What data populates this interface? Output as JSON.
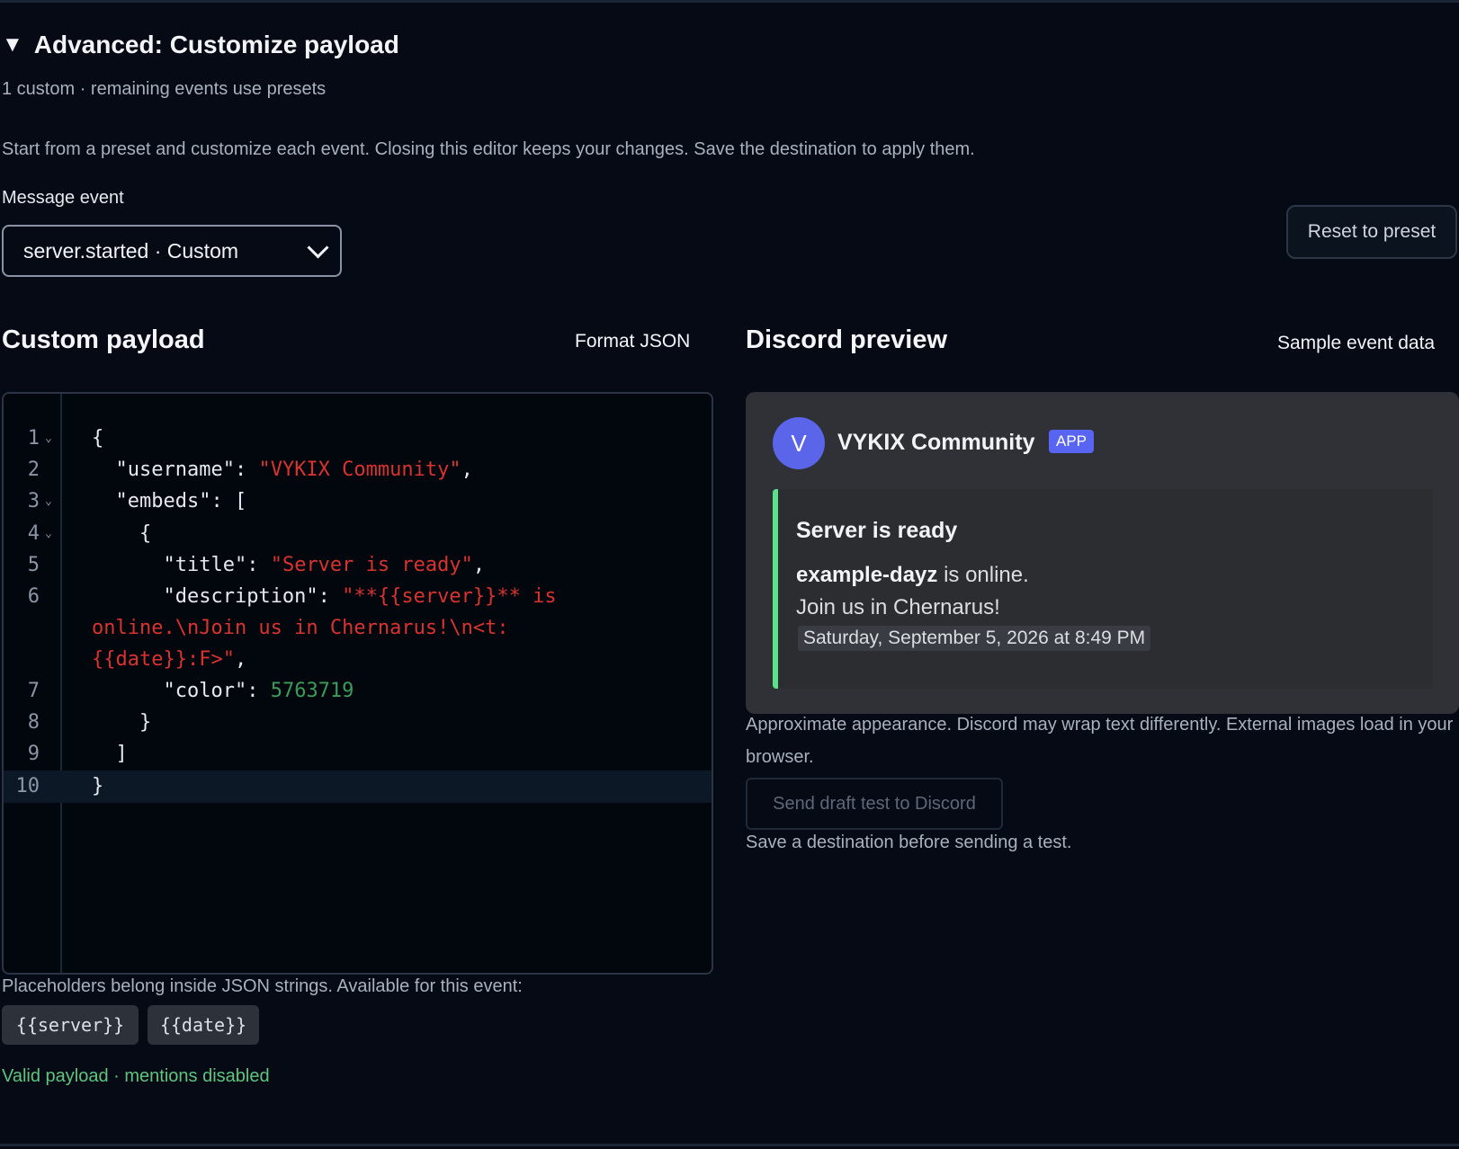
{
  "section": {
    "title": "Advanced: Customize payload",
    "summary": "1 custom · remaining events use presets",
    "intro": "Start from a preset and customize each event. Closing this editor keeps your changes. Save the destination to apply them."
  },
  "event_select": {
    "label": "Message event",
    "value": "server.started · Custom"
  },
  "reset_label": "Reset to preset",
  "editor": {
    "heading": "Custom payload",
    "format_label": "Format JSON",
    "lines": [
      {
        "n": "1",
        "text": "{"
      },
      {
        "n": "2",
        "key": "\"username\": ",
        "str": "\"VYKIX Community\"",
        "tail": ","
      },
      {
        "n": "3",
        "text": "\"embeds\": ["
      },
      {
        "n": "4",
        "text": "{"
      },
      {
        "n": "5",
        "key": "\"title\": ",
        "str": "\"Server is ready\"",
        "tail": ","
      },
      {
        "n": "6",
        "key": "\"description\": ",
        "str": "\"**{{server}}** is"
      },
      {
        "n": "",
        "str": "online.\\nJoin us in Chernarus!\\n<t:"
      },
      {
        "n": "",
        "str": "{{date}}:F>\"",
        "tail": ","
      },
      {
        "n": "7",
        "key": "\"color\": ",
        "num": "5763719"
      },
      {
        "n": "8",
        "text": "}"
      },
      {
        "n": "9",
        "text": "]"
      },
      {
        "n": "10",
        "text": "}"
      }
    ],
    "placeholder_note": "Placeholders belong inside JSON strings. Available for this event:",
    "placeholders": [
      "{{server}}",
      "{{date}}"
    ],
    "status": "Valid payload · mentions disabled"
  },
  "preview": {
    "heading": "Discord preview",
    "sample_label": "Sample event data",
    "avatar_letter": "V",
    "bot_name": "VYKIX Community",
    "badge": "APP",
    "embed_title": "Server is ready",
    "embed_server": "example-dayz",
    "embed_line1_rest": " is online.",
    "embed_line2": "Join us in Chernarus!",
    "embed_time": "Saturday, September 5, 2026 at 8:49 PM",
    "accent_color": "#57e389",
    "note": "Approximate appearance. Discord may wrap text differently. External images load in your browser.",
    "send_label": "Send draft test to Discord",
    "save_note": "Save a destination before sending a test."
  }
}
